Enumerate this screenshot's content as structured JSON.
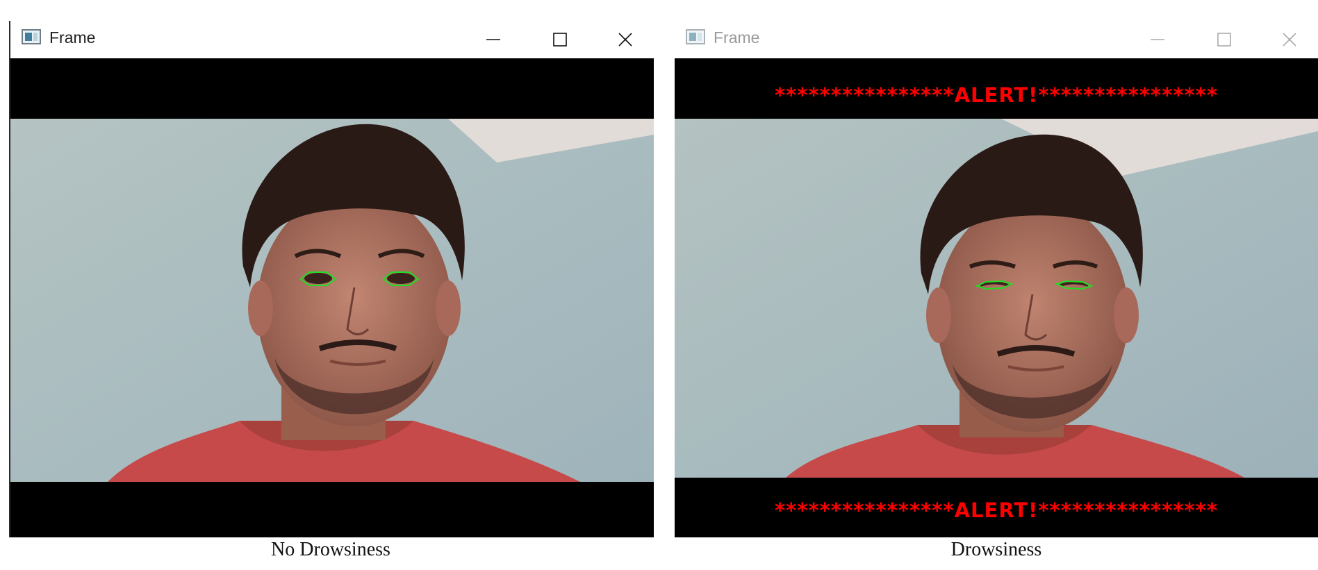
{
  "windows": [
    {
      "title": "Frame",
      "state": "No Drowsiness",
      "alert_top": "",
      "alert_bottom": "",
      "controls": {
        "minimize": "minimize-icon",
        "maximize": "maximize-icon",
        "close": "close-icon"
      }
    },
    {
      "title": "Frame",
      "state": "Drowsiness",
      "alert_top": "****************ALERT!****************",
      "alert_bottom": "****************ALERT!****************",
      "controls": {
        "minimize": "minimize-icon",
        "maximize": "maximize-icon",
        "close": "close-icon"
      }
    }
  ],
  "captions": {
    "left": "No Drowsiness",
    "right": "Drowsiness"
  },
  "colors": {
    "alert": "#ff0000",
    "eye_contour": "#22dd22",
    "letterbox": "#000000",
    "wall": "#a9bcbf",
    "shirt": "#c64a4a"
  }
}
